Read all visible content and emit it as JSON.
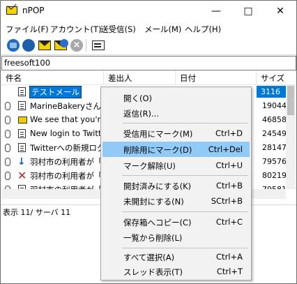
{
  "window": {
    "title": "nPOP"
  },
  "menubar": {
    "items": [
      "ファイル(F)",
      "アカウント(T)",
      "送受信(S)",
      "メール(M)",
      "ヘルプ(H)"
    ]
  },
  "toolbar": {
    "icons": [
      "check-mail-icon",
      "send-receive-icon",
      "new-mail-icon",
      "reply-mail-icon",
      "stop-icon",
      "mailbox-list-icon"
    ]
  },
  "account": {
    "value": "freesoft100"
  },
  "list": {
    "columns": [
      "件名",
      "差出人",
      "日付",
      "サイズ"
    ],
    "rows": [
      {
        "subject": "テストメール",
        "size": "3116",
        "icon": "document-icon",
        "attachment": false,
        "selected": true
      },
      {
        "subject": "MarineBakeryさん、.",
        "size": "19044",
        "icon": "document-icon",
        "attachment": true
      },
      {
        "subject": "We see that you're...",
        "size": "46858",
        "icon": "envelope-icon",
        "attachment": true
      },
      {
        "subject": "New login to Twitt...",
        "size": "24549",
        "icon": "document-icon",
        "attachment": true
      },
      {
        "subject": "Twitterへの新規ログ...",
        "size": "28147",
        "icon": "document-icon",
        "attachment": true
      },
      {
        "subject": "羽村市の利用者が「...",
        "size": "79576",
        "icon": "download-arrow-icon",
        "attachment": true
      },
      {
        "subject": "羽村市の利用者が「...",
        "size": "80219",
        "icon": "delete-mark-icon",
        "attachment": true
      },
      {
        "subject": "羽村市の利用者が「...",
        "size": "79581",
        "icon": "document-icon",
        "attachment": true
      }
    ]
  },
  "status": {
    "text": "表示 11/ サーバ 11"
  },
  "context_menu": {
    "groups": [
      [
        {
          "label": "開く(O)",
          "shortcut": ""
        },
        {
          "label": "返信(R)...",
          "shortcut": ""
        }
      ],
      [
        {
          "label": "受信用にマーク(M)",
          "shortcut": "Ctrl+D"
        },
        {
          "label": "削除用にマーク(D)",
          "shortcut": "Ctrl+Del",
          "highlighted": true
        },
        {
          "label": "マーク解除(U)",
          "shortcut": "Ctrl+U"
        }
      ],
      [
        {
          "label": "開封済みにする(K)",
          "shortcut": "Ctrl+B"
        },
        {
          "label": "未開封にする(N)",
          "shortcut": "SCtrl+B"
        }
      ],
      [
        {
          "label": "保存箱へコピー(C)",
          "shortcut": "Ctrl+C"
        },
        {
          "label": "一覧から削除(L)",
          "shortcut": ""
        }
      ],
      [
        {
          "label": "すべて選択(A)",
          "shortcut": "Ctrl+A"
        },
        {
          "label": "スレッド表示(T)",
          "shortcut": "Ctrl+T"
        }
      ]
    ]
  },
  "colors": {
    "selection": "#0078d7",
    "menu_highlight": "#91c9f7",
    "menu_bg": "#f2f2f2"
  }
}
